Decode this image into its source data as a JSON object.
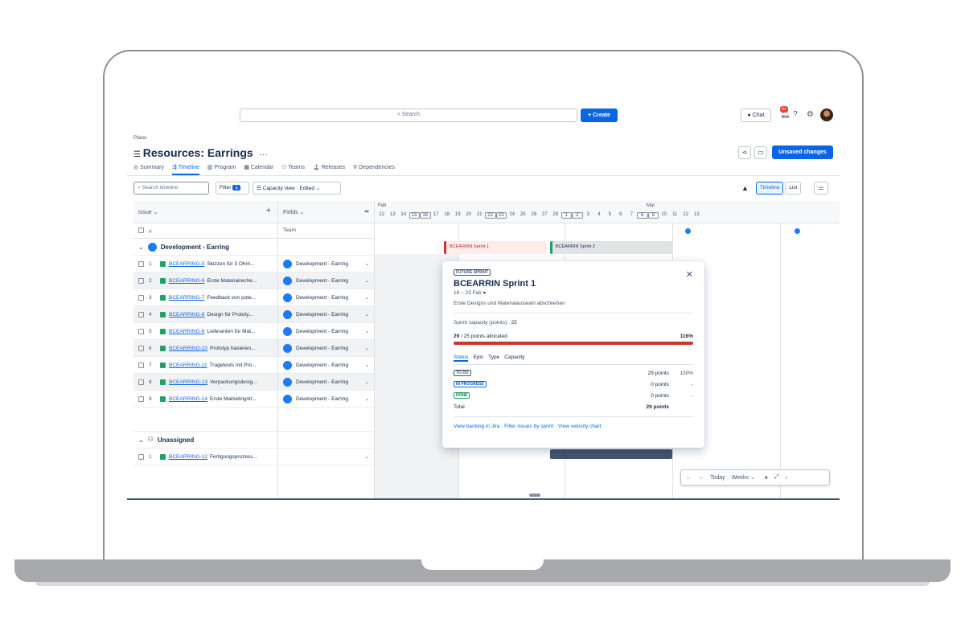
{
  "topbar": {
    "search_placeholder": "Search",
    "create_label": "+ Create",
    "chat_label": "Chat",
    "notif_count": "9+"
  },
  "breadcrumb": "Plans",
  "title": "Resources: Earrings",
  "title_more": "···",
  "unsaved_label": "Unsaved changes",
  "tabs": [
    "Summary",
    "Timeline",
    "Program",
    "Calendar",
    "Teams",
    "Releases",
    "Dependencies"
  ],
  "toolbar": {
    "search_placeholder": "Search timeline",
    "filter_label": "Filter",
    "filter_count": "1",
    "capacity_label": "Capacity view · Edited",
    "view_timeline": "Timeline",
    "view_list": "List"
  },
  "columns": {
    "issue": "Issue",
    "fields": "Fields",
    "hash": "#",
    "team": "Team"
  },
  "timeline": {
    "months": [
      "Feb",
      "Mar"
    ],
    "days": [
      "12",
      "13",
      "14",
      "15",
      "16",
      "17",
      "18",
      "19",
      "20",
      "21",
      "22",
      "23",
      "24",
      "25",
      "26",
      "27",
      "28",
      "1",
      "2",
      "3",
      "4",
      "5",
      "6",
      "7",
      "8",
      "9",
      "10",
      "11",
      "12",
      "13"
    ],
    "sprint1": "BCEARRIN Sprint 1",
    "sprint2": "BCEARRIN Sprint 2"
  },
  "groups": [
    {
      "name": "Development - Earring",
      "rows": [
        {
          "num": "1",
          "key": "BCEARRING-5",
          "summary": "Skizzen für 3 Ohrri...",
          "team": "Development - Earring"
        },
        {
          "num": "2",
          "key": "BCEARRING-6",
          "summary": "Erste Materialreche...",
          "team": "Development - Earring"
        },
        {
          "num": "3",
          "key": "BCEARRING-7",
          "summary": "Feedback von pote...",
          "team": "Development - Earring"
        },
        {
          "num": "4",
          "key": "BCEARRING-8",
          "summary": "Design für Prototy...",
          "team": "Development - Earring"
        },
        {
          "num": "5",
          "key": "BCEARRING-9",
          "summary": "Lieferanten für Mat...",
          "team": "Development - Earring"
        },
        {
          "num": "6",
          "key": "BCEARRING-10",
          "summary": "Prototyp basieren...",
          "team": "Development - Earring"
        },
        {
          "num": "7",
          "key": "BCEARRING-11",
          "summary": "Tragetests mit Pro...",
          "team": "Development - Earring"
        },
        {
          "num": "8",
          "key": "BCEARRING-13",
          "summary": "Verpackungsdesig...",
          "team": "Development - Earring"
        },
        {
          "num": "9",
          "key": "BCEARRING-14",
          "summary": "Erste Marketingstr...",
          "team": "Development - Earring"
        }
      ]
    },
    {
      "name": "Unassigned",
      "rows": [
        {
          "num": "1",
          "key": "BCEARRING-12",
          "summary": "Fertigungsprozess...",
          "team": ""
        }
      ]
    }
  ],
  "popup": {
    "badge": "FUTURE SPRINT",
    "title": "BCEARRIN Sprint 1",
    "dates": "16 – 23 Feb",
    "goal": "Erste Designs und Materialauswahl abschließen",
    "capacity_label": "Sprint capacity (points):",
    "capacity_value": "25",
    "allocated_count": "29",
    "allocated_rest": " / 25 points allocated",
    "allocated_pct": "116%",
    "allocated_fill": 1.0,
    "tabs": [
      "Status",
      "Epic",
      "Type",
      "Capacity"
    ],
    "statuses": [
      {
        "label": "TO DO",
        "value": "29 points",
        "pct": "100%"
      },
      {
        "label": "IN PROGRESS",
        "value": "0 points",
        "pct": "-"
      },
      {
        "label": "DONE",
        "value": "0 points",
        "pct": "-"
      }
    ],
    "total_label": "Total",
    "total_value": "29 points",
    "links": "View backlog in Jira · Filter issues by sprint · View velocity chart"
  },
  "nav": {
    "today": "Today",
    "scale": "Weeks"
  },
  "colors": {
    "accent": "#0c66e4",
    "over_capacity": "#c9372c",
    "story": "#22a06b"
  }
}
